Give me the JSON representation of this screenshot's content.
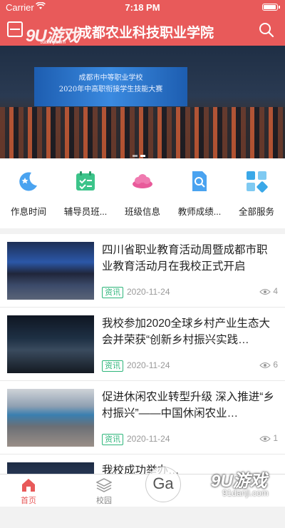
{
  "status_bar": {
    "carrier": "Carrier",
    "time": "7:18 PM"
  },
  "header": {
    "title": "成都农业科技职业学院",
    "logo_text": "9U游戏",
    "logo_sub": "91danji.com"
  },
  "banner": {
    "screen_line1": "成都市中等职业学校",
    "screen_line2": "2020年中高职衔接学生技能大赛",
    "slides": 2,
    "active_slide": 1
  },
  "quick_links": [
    {
      "label": "作息时间",
      "icon": "moon-star-icon",
      "color": "#4aa3f0"
    },
    {
      "label": "辅导员班...",
      "icon": "calendar-check-icon",
      "color": "#3cc48a"
    },
    {
      "label": "班级信息",
      "icon": "cloud-icon",
      "color": "#e85a9a"
    },
    {
      "label": "教师成绩...",
      "icon": "document-search-icon",
      "color": "#4aa3f0"
    },
    {
      "label": "全部服务",
      "icon": "grid-icon",
      "color": "#3aa8e8"
    }
  ],
  "news": [
    {
      "title": "四川省职业教育活动周暨成都市职业教育活动月在我校正式开启",
      "tag": "资讯",
      "date": "2020-11-24",
      "views": "4"
    },
    {
      "title": "我校参加2020全球乡村产业生态大会并荣获“创新乡村振兴实践…",
      "tag": "资讯",
      "date": "2020-11-24",
      "views": "6"
    },
    {
      "title": "促进休闲农业转型升级 深入推进“乡村振兴”——中国休闲农业…",
      "tag": "资讯",
      "date": "2020-11-24",
      "views": "1"
    },
    {
      "title": "我校成功举办…",
      "tag": "",
      "date": "",
      "views": ""
    }
  ],
  "tabs": [
    {
      "label": "首页",
      "icon": "home-icon",
      "active": true
    },
    {
      "label": "校园",
      "icon": "layers-icon",
      "active": false
    }
  ],
  "watermark": {
    "big": "9U游戏",
    "small": "91danji.com",
    "badge": "Ga"
  },
  "colors": {
    "brand": "#e85a5a",
    "tag": "#2db57a"
  }
}
